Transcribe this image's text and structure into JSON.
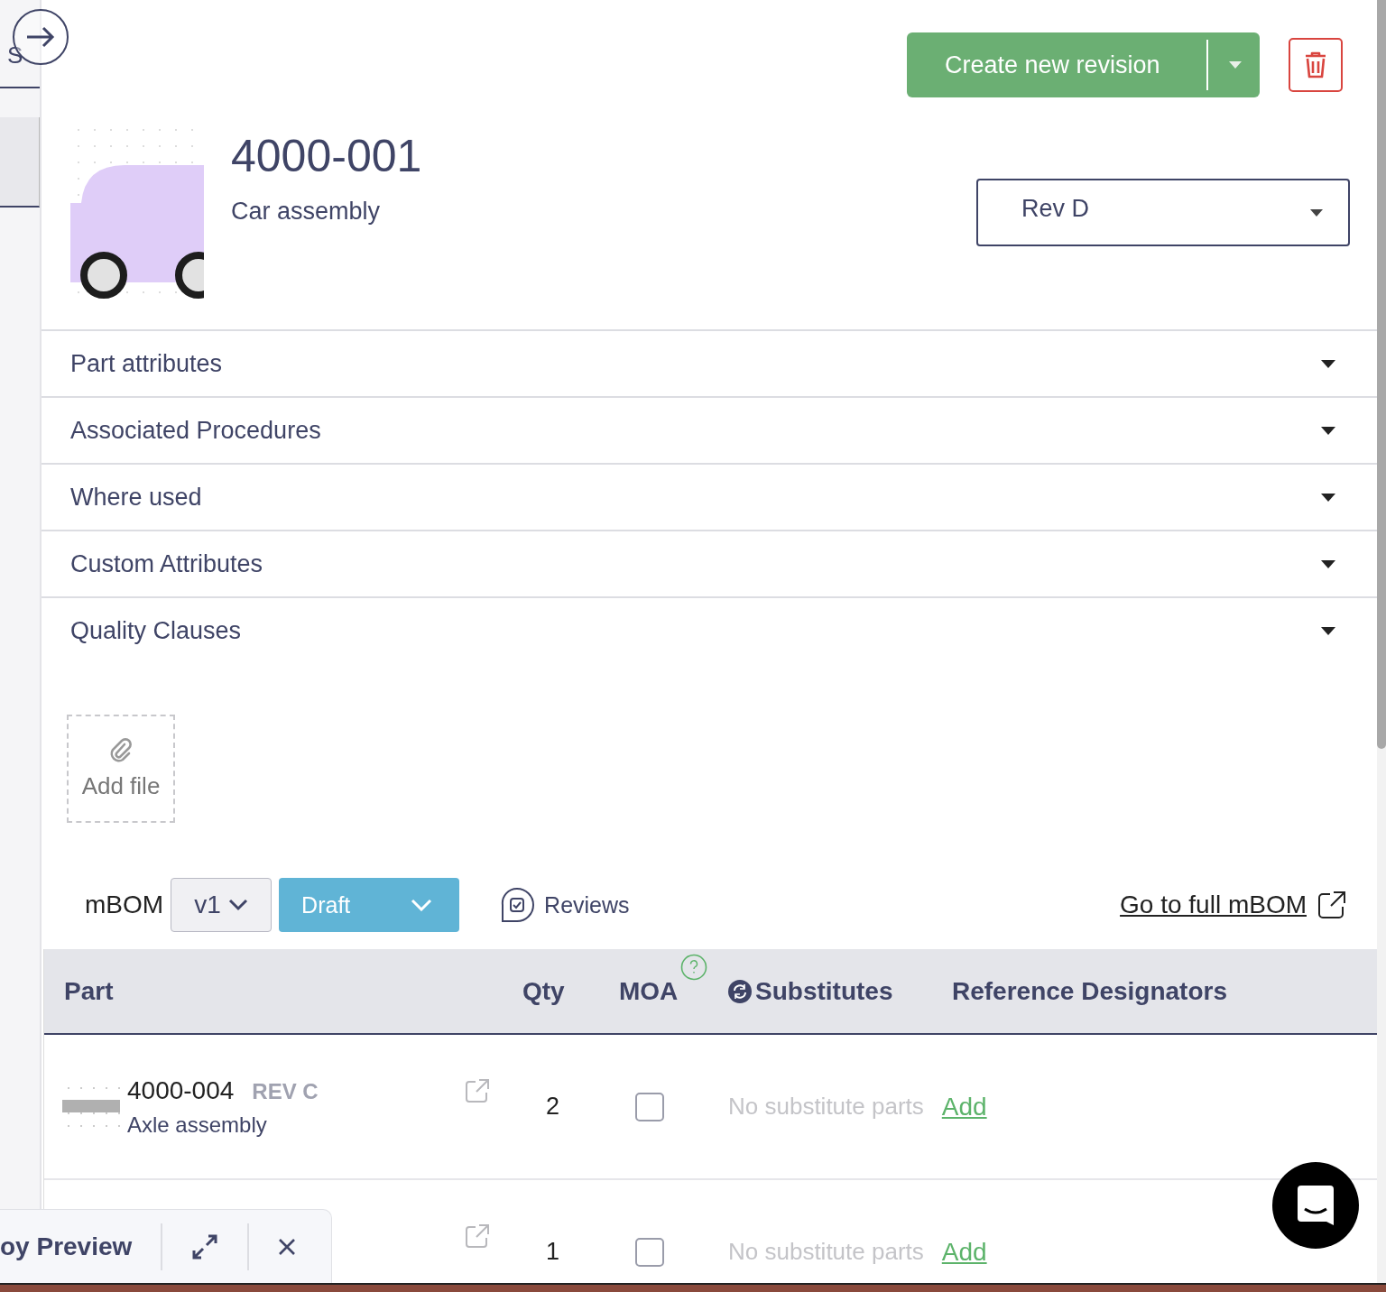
{
  "background_panel": {
    "label": "S"
  },
  "header": {
    "create_button": "Create new revision",
    "part_number": "4000-001",
    "description": "Car assembly",
    "revision": "Rev D"
  },
  "sections": [
    {
      "title": "Part attributes",
      "expanded": false
    },
    {
      "title": "Associated Procedures",
      "expanded": false
    },
    {
      "title": "Where used",
      "expanded": false
    },
    {
      "title": "Custom Attributes",
      "expanded": false
    },
    {
      "title": "Quality Clauses",
      "expanded": false
    }
  ],
  "attachments": {
    "add_label": "Add file"
  },
  "bom": {
    "label": "mBOM",
    "version": "v1",
    "status": "Draft",
    "reviews": "Reviews",
    "full_link": "Go to full mBOM",
    "columns": [
      "Part",
      "Qty",
      "MOA",
      "Substitutes",
      "Reference Designators"
    ],
    "rows": [
      {
        "part_number": "4000-004",
        "revision": "REV C",
        "description": "Axle assembly",
        "qty": "2",
        "moa": false,
        "substitutes": "No substitute parts",
        "add": "Add"
      },
      {
        "qty": "1",
        "moa": false,
        "substitutes": "No substitute parts",
        "add": "Add"
      }
    ]
  },
  "preview_bar": {
    "title": "oy Preview"
  }
}
